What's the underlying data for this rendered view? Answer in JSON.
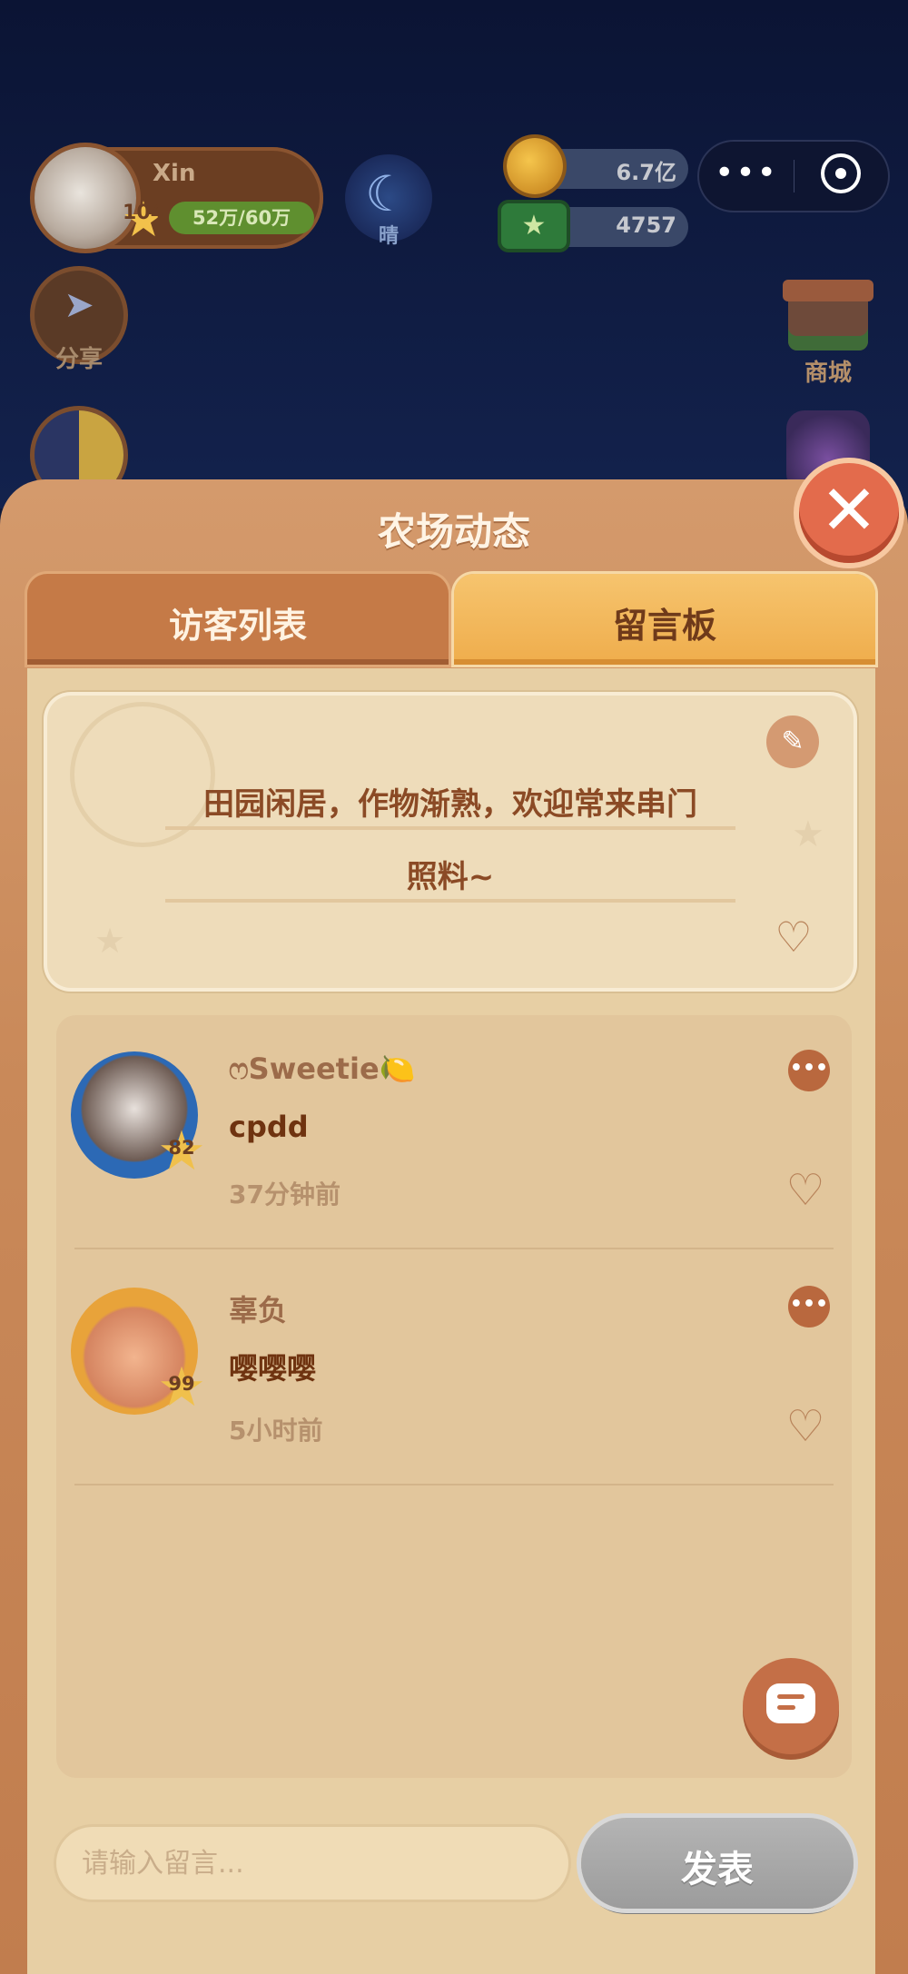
{
  "hud": {
    "username": "Xin",
    "level": "104",
    "xp_text": "52万/60万",
    "weather_label": "晴",
    "coins": "6.7亿",
    "cash": "4757"
  },
  "side_buttons": {
    "share_label": "分享",
    "shop_label": "商城"
  },
  "panel": {
    "title": "农场动态",
    "tabs": [
      {
        "label": "访客列表",
        "active": false
      },
      {
        "label": "留言板",
        "active": true
      }
    ]
  },
  "motto": {
    "line1": "田园闲居，作物渐熟，欢迎常来串门",
    "line2": "照料~"
  },
  "messages": [
    {
      "name": "ෆSweetie🍋",
      "level": "82",
      "text": "cpdd",
      "time": "37分钟前"
    },
    {
      "name": "辜负",
      "level": "99",
      "text": "嘤嘤嘤",
      "time": "5小时前"
    }
  ],
  "composer": {
    "placeholder": "请输入留言...",
    "send_label": "发表"
  },
  "colors": {
    "panel": "#c98959",
    "active_tab": "#efad4c",
    "accent": "#c46f47",
    "send_disabled": "#9c9c9c"
  },
  "icons": {
    "close": "close-icon",
    "edit": "edit-icon",
    "like": "heart-icon",
    "more": "more-icon",
    "chat": "chat-icon"
  }
}
